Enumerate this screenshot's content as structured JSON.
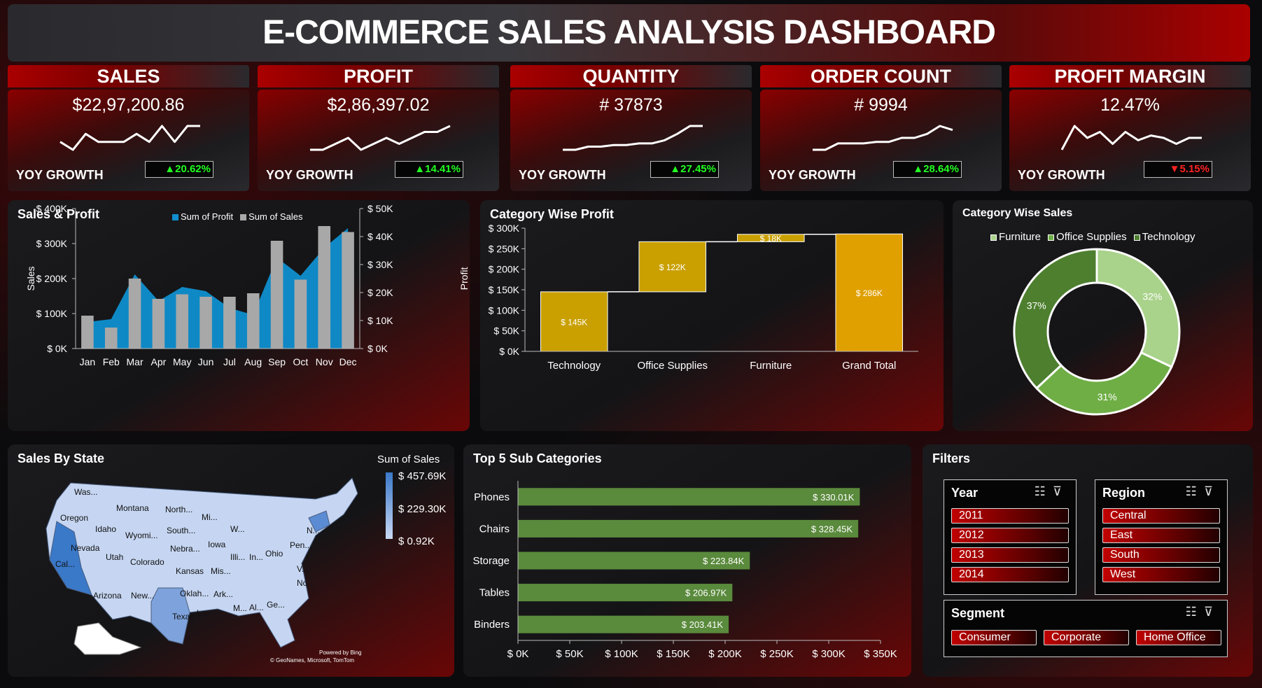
{
  "title": "E-COMMERCE SALES ANALYSIS DASHBOARD",
  "kpis": [
    {
      "label": "SALES",
      "value": "$22,97,200.86",
      "yoy_label": "YOY GROWTH",
      "yoy": "▲20.62%",
      "dir": "up",
      "spark": [
        4,
        3,
        5,
        4,
        4,
        4,
        5,
        4,
        6,
        4,
        6,
        6
      ]
    },
    {
      "label": "PROFIT",
      "value": "$2,86,397.02",
      "yoy_label": "YOY GROWTH",
      "yoy": "▲14.41%",
      "dir": "up",
      "spark": [
        3,
        3,
        4,
        5,
        3,
        4,
        5,
        4,
        5,
        6,
        6,
        7
      ]
    },
    {
      "label": "QUANTITY",
      "value": "# 37873",
      "yoy_label": "YOY GROWTH",
      "yoy": "▲27.45%",
      "dir": "up",
      "spark": [
        3,
        3,
        3.2,
        3.2,
        3.3,
        3.3,
        3.4,
        3.4,
        3.6,
        4,
        4.5,
        4.5
      ]
    },
    {
      "label": "ORDER COUNT",
      "value": "# 9994",
      "yoy_label": "YOY GROWTH",
      "yoy": "▲28.64%",
      "dir": "up",
      "spark": [
        3,
        3,
        3.8,
        3.8,
        3.8,
        4,
        4,
        4.5,
        4.5,
        5,
        6,
        5.5
      ]
    },
    {
      "label": "PROFIT MARGIN",
      "value": "12.47%",
      "yoy_label": "YOY GROWTH",
      "yoy": "▼5.15%",
      "dir": "down",
      "spark": [
        5,
        7,
        6,
        6.5,
        5.5,
        6.5,
        5.8,
        6.2,
        6,
        5.5,
        6,
        6
      ]
    }
  ],
  "chart_data": [
    {
      "type": "bar+area",
      "title": "Sales & Profit",
      "categories": [
        "Jan",
        "Feb",
        "Mar",
        "Apr",
        "May",
        "Jun",
        "Jul",
        "Aug",
        "Sep",
        "Oct",
        "Nov",
        "Dec"
      ],
      "series": [
        {
          "name": "Sum of Sales",
          "type": "bar",
          "axis": "left",
          "values": [
            94000,
            60000,
            200000,
            142000,
            155000,
            148000,
            148000,
            158000,
            308000,
            197000,
            350000,
            333000
          ]
        },
        {
          "name": "Sum of Profit",
          "type": "area",
          "axis": "right",
          "values": [
            9500,
            10500,
            26500,
            17000,
            22000,
            20500,
            14500,
            12000,
            32500,
            26000,
            36000,
            43000
          ]
        }
      ],
      "ylabel": "Sales",
      "y2label": "Profit",
      "yticks": [
        "$ 0K",
        "$ 100K",
        "$ 200K",
        "$ 300K",
        "$ 400K"
      ],
      "ylim": [
        0,
        400000
      ],
      "y2ticks": [
        "$ 0K",
        "$ 10K",
        "$ 20K",
        "$ 30K",
        "$ 40K",
        "$ 50K"
      ],
      "y2lim": [
        0,
        50000
      ],
      "colors": {
        "Sum of Sales": "#a8a8a8",
        "Sum of Profit": "#0f8fcf"
      },
      "legend": "top"
    },
    {
      "type": "bar",
      "subtype": "waterfall",
      "title": "Category Wise Profit",
      "categories": [
        "Technology",
        "Office Supplies",
        "Furniture",
        "Grand Total"
      ],
      "values": [
        145000,
        122000,
        18000,
        286000
      ],
      "labels": [
        "$ 145K",
        "$ 122K",
        "$ 18K",
        "$ 286K"
      ],
      "yticks": [
        "$ 0K",
        "$ 50K",
        "$ 100K",
        "$ 150K",
        "$ 200K",
        "$ 250K",
        "$ 300K"
      ],
      "ylim": [
        0,
        300000
      ],
      "colors": {
        "bar": "#c9a000",
        "total": "#e0a000"
      }
    },
    {
      "type": "pie",
      "subtype": "donut",
      "title": "Category Wise Sales",
      "categories": [
        "Furniture",
        "Office Supplies",
        "Technology"
      ],
      "values": [
        32,
        31,
        37
      ],
      "labels": [
        "32%",
        "31%",
        "37%"
      ],
      "colors": [
        "#a9d28a",
        "#6fae45",
        "#4d7f2f"
      ],
      "legend": "top"
    },
    {
      "type": "bar",
      "orientation": "horizontal",
      "title": "Top 5 Sub Categories",
      "categories": [
        "Phones",
        "Chairs",
        "Storage",
        "Tables",
        "Binders"
      ],
      "values": [
        330010,
        328450,
        223840,
        206970,
        203410
      ],
      "labels": [
        "$ 330.01K",
        "$ 328.45K",
        "$ 223.84K",
        "$ 206.97K",
        "$ 203.41K"
      ],
      "xticks": [
        "$ 0K",
        "$ 50K",
        "$ 100K",
        "$ 150K",
        "$ 200K",
        "$ 250K",
        "$ 300K",
        "$ 350K"
      ],
      "xlim": [
        0,
        350000
      ],
      "colors": {
        "bar": "#5a8a3c"
      }
    }
  ],
  "map": {
    "title": "Sales By State",
    "legend_title": "Sum of Sales",
    "legend_max": "$ 457.69K",
    "legend_mid": "$ 229.30K",
    "legend_min": "$ 0.92K",
    "states": [
      "Was...",
      "Montana",
      "North...",
      "Mi...",
      "Oregon",
      "Idaho",
      "Wyomi...",
      "South...",
      "W...",
      "N...",
      "Nevada",
      "Utah",
      "Nebra...",
      "Iowa",
      "Pen...",
      "Cal...",
      "Colorado",
      "Kansas",
      "Mis...",
      "Illi...",
      "In...",
      "Ohio",
      "V...",
      "No...",
      "Arizona",
      "New...",
      "Oklah...",
      "Ark...",
      "Texas",
      "L...",
      "M...",
      "Al...",
      "Ge..."
    ],
    "credits": [
      "Powered by Bing",
      "© GeoNames, Microsoft, TomTom"
    ]
  },
  "filters": {
    "title": "Filters",
    "year": {
      "label": "Year",
      "options": [
        "2011",
        "2012",
        "2013",
        "2014"
      ]
    },
    "region": {
      "label": "Region",
      "options": [
        "Central",
        "East",
        "South",
        "West"
      ]
    },
    "segment": {
      "label": "Segment",
      "options": [
        "Consumer",
        "Corporate",
        "Home Office"
      ]
    }
  }
}
